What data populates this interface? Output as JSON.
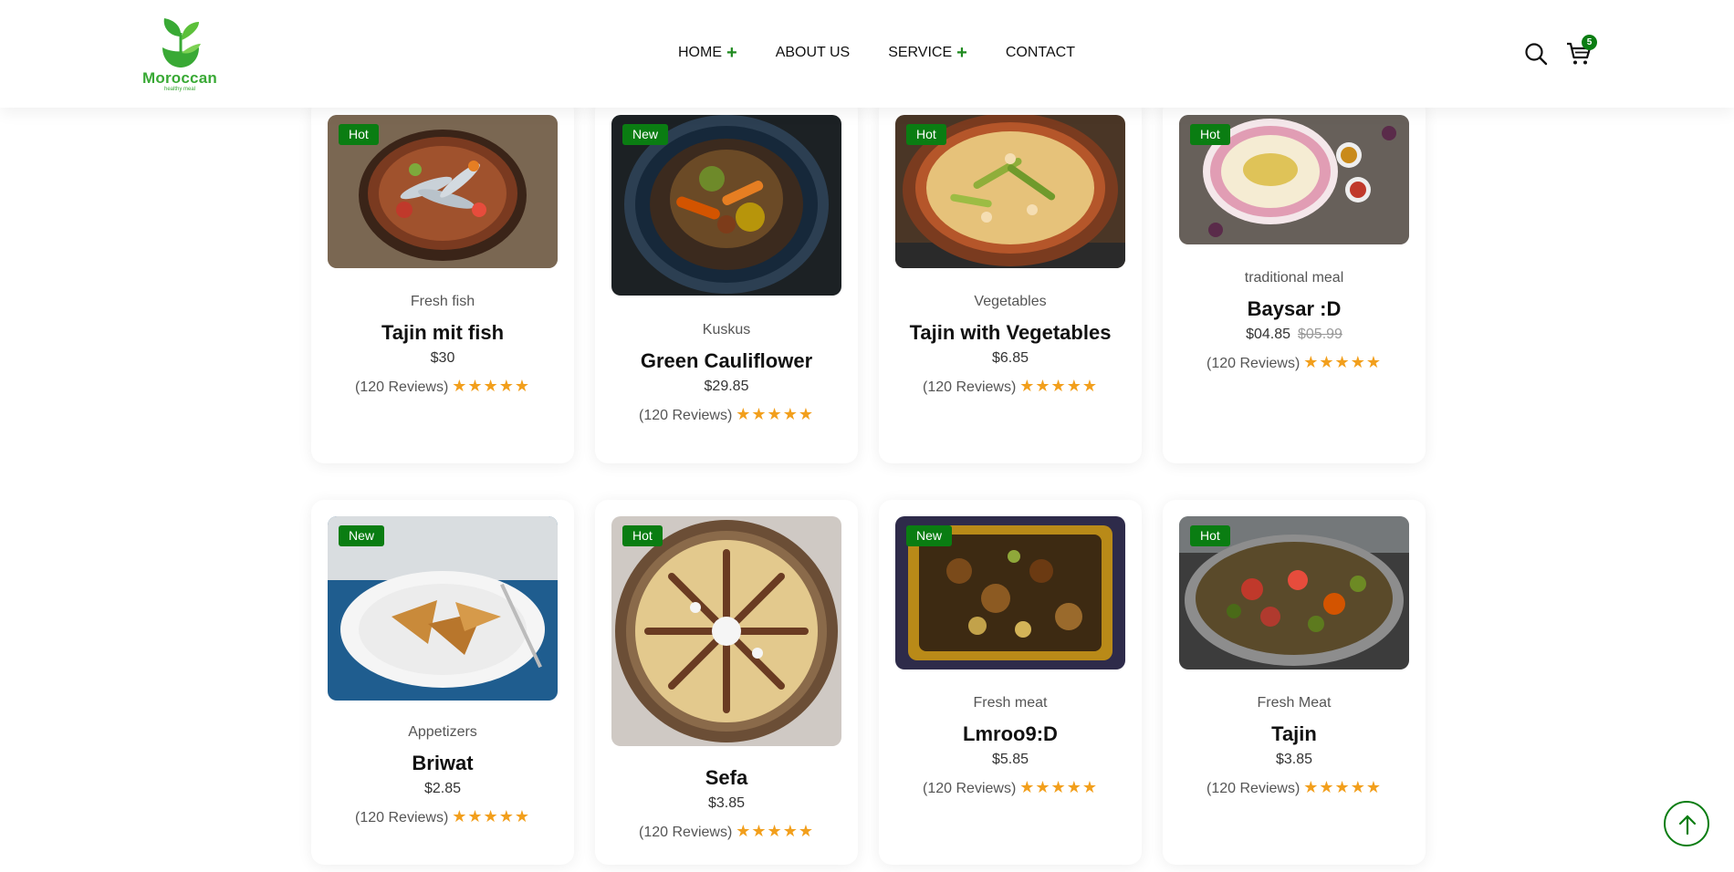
{
  "brand": {
    "name": "Moroccan",
    "tagline": "healthy meal",
    "color": "#39a935"
  },
  "nav": [
    {
      "label": "HOME",
      "plus": "+"
    },
    {
      "label": "ABOUT US",
      "plus": ""
    },
    {
      "label": "SERVICE",
      "plus": "+"
    },
    {
      "label": "CONTACT",
      "plus": ""
    }
  ],
  "header_icons": {
    "search": "search-icon",
    "cart": "cart-icon",
    "cart_count": "5"
  },
  "accent_color": "#0a7d12",
  "star_color": "#f29f1c",
  "products": [
    {
      "badge": "Hot",
      "category": "Fresh fish",
      "title": "Tajin mit fish",
      "price": "$30",
      "old_price": "",
      "reviews": "(120 Reviews)",
      "stars": "★★★★★"
    },
    {
      "badge": "New",
      "category": "Kuskus",
      "title": "Green Cauliflower",
      "price": "$29.85",
      "old_price": "",
      "reviews": "(120 Reviews)",
      "stars": "★★★★★"
    },
    {
      "badge": "Hot",
      "category": "Vegetables",
      "title": "Tajin with Vegetables",
      "price": "$6.85",
      "old_price": "",
      "reviews": "(120 Reviews)",
      "stars": "★★★★★"
    },
    {
      "badge": "Hot",
      "category": "traditional meal",
      "title": "Baysar :D",
      "price": "$04.85",
      "old_price": "$05.99",
      "reviews": "(120 Reviews)",
      "stars": "★★★★★"
    },
    {
      "badge": "New",
      "category": "Appetizers",
      "title": "Briwat",
      "price": "$2.85",
      "old_price": "",
      "reviews": "(120 Reviews)",
      "stars": "★★★★★"
    },
    {
      "badge": "Hot",
      "category": "",
      "title": "Sefa",
      "price": "$3.85",
      "old_price": "",
      "reviews": "(120 Reviews)",
      "stars": "★★★★★"
    },
    {
      "badge": "New",
      "category": "Fresh meat",
      "title": "Lmroo9:D",
      "price": "$5.85",
      "old_price": "",
      "reviews": "(120 Reviews)",
      "stars": "★★★★★"
    },
    {
      "badge": "Hot",
      "category": "Fresh Meat",
      "title": "Tajin",
      "price": "$3.85",
      "old_price": "",
      "reviews": "(120 Reviews)",
      "stars": "★★★★★"
    }
  ],
  "scroll_top": "arrow-up-icon"
}
